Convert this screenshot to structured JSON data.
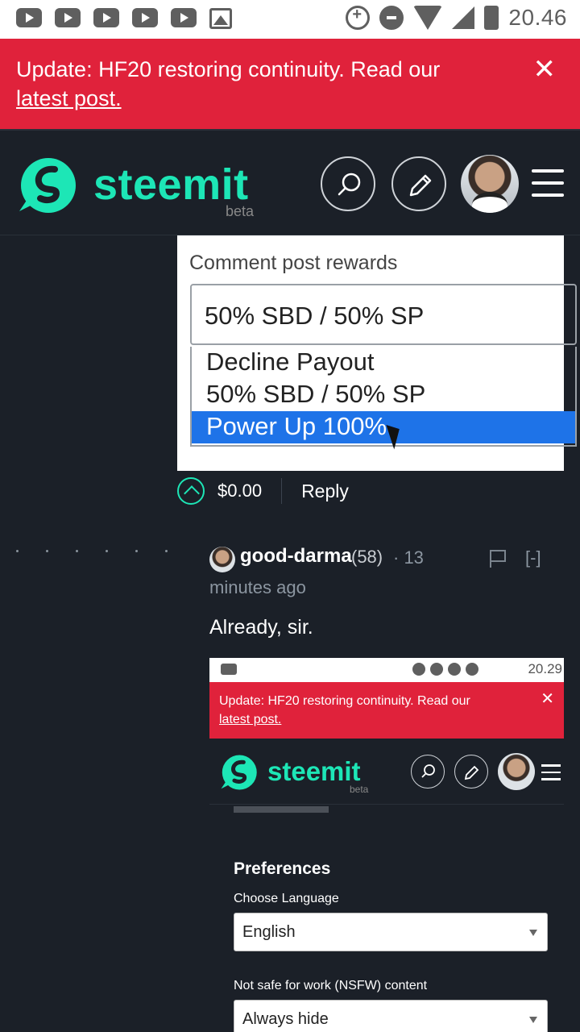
{
  "status_bar": {
    "time": "20.46"
  },
  "banner": {
    "text": "Update: HF20 restoring continuity. Read our",
    "link": "latest post.",
    "close": "✕"
  },
  "header": {
    "logo": "steemit",
    "beta": "beta"
  },
  "rewards_screenshot": {
    "label": "Comment post rewards",
    "selected": "50% SBD / 50% SP",
    "options": [
      "Decline Payout",
      "50% SBD / 50% SP",
      "Power Up 100%"
    ],
    "highlighted_index": 2
  },
  "vote": {
    "amount": "$0.00",
    "reply": "Reply"
  },
  "comment": {
    "author": "good-darma",
    "reputation": "(58)",
    "time_part1": "· 13",
    "time_part2": "minutes ago",
    "collapse": "[-]",
    "body": "Already, sir."
  },
  "embedded_screenshot": {
    "time": "20.29",
    "banner_text": "Update: HF20 restoring continuity. Read our",
    "banner_link": "latest post.",
    "close": "✕",
    "logo": "steemit",
    "beta": "beta",
    "preferences_title": "Preferences",
    "language_label": "Choose Language",
    "language_value": "English",
    "nsfw_label": "Not safe for work (NSFW) content",
    "nsfw_value": "Always hide"
  },
  "colors": {
    "accent": "#1de6b6",
    "banner": "#e0223b",
    "background": "#1b2028",
    "selection": "#1e73e8"
  }
}
